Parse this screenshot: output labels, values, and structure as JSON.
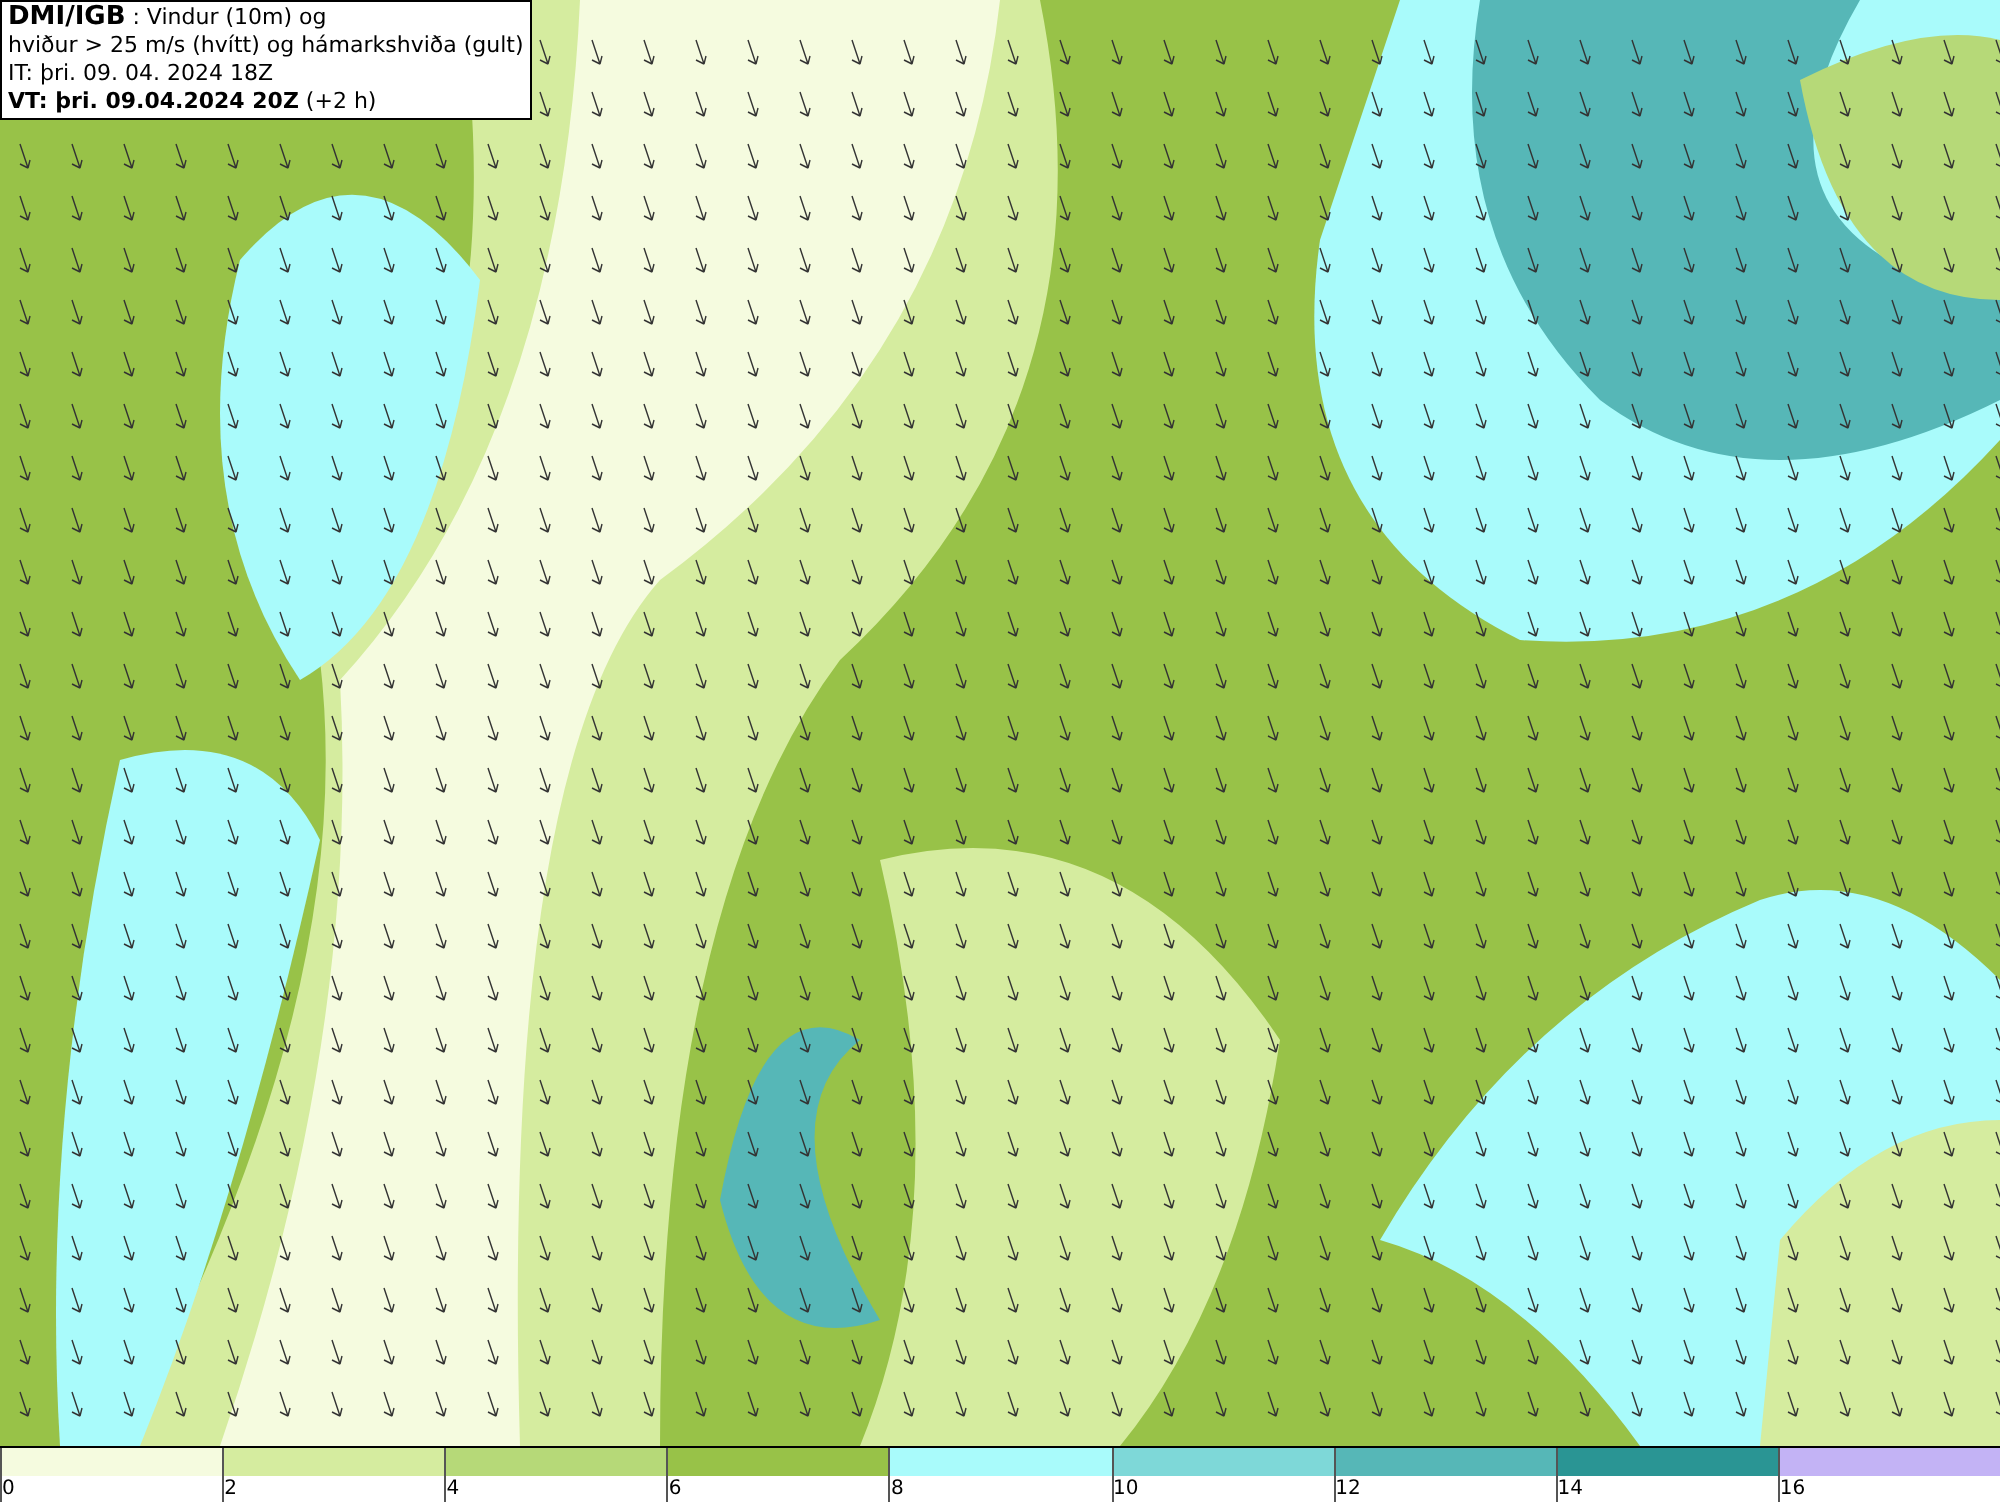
{
  "title_box": {
    "source": "DMI/IGB",
    "description": " : Vindur (10m) og",
    "line_2": "hviður > 25 m/s (hvítt) og hámarkshviða (gult)",
    "issue_time": "IT: þri. 09. 04. 2024 18Z",
    "valid_time": "VT: þri. 09.04.2024 20Z",
    "lead": " (+2 h)"
  },
  "legend": [
    {
      "label": "0",
      "color": "#f5fbdf"
    },
    {
      "label": "2",
      "color": "#d5ec9f"
    },
    {
      "label": "4",
      "color": "#b6d978"
    },
    {
      "label": "6",
      "color": "#98c248"
    },
    {
      "label": "8",
      "color": "#a9fbfb"
    },
    {
      "label": "10",
      "color": "#7ed8d8"
    },
    {
      "label": "12",
      "color": "#56b7b7"
    },
    {
      "label": "14",
      "color": "#2a9594"
    },
    {
      "label": "16",
      "color": "#c3b3f5"
    }
  ]
}
